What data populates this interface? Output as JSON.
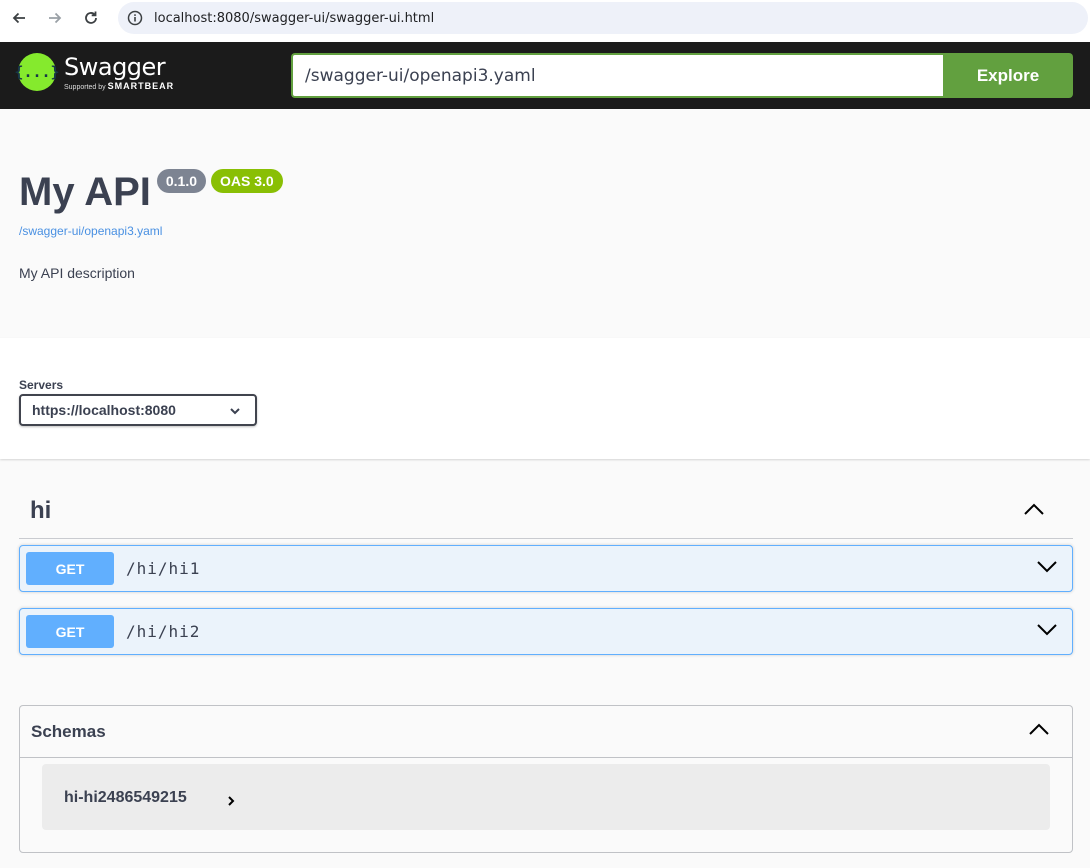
{
  "browser": {
    "url": "localhost:8080/swagger-ui/swagger-ui.html",
    "icons": [
      "back-arrow-icon",
      "forward-arrow-icon",
      "reload-icon",
      "info-icon"
    ]
  },
  "topbar": {
    "logo_glyph": "{...}",
    "logo_title": "Swagger",
    "logo_supported": "Supported by",
    "logo_smartbear": "SMARTBEAR",
    "spec_url_value": "/swagger-ui/openapi3.yaml",
    "explore_label": "Explore",
    "colors": {
      "background": "#1b1b1b",
      "accent": "#62a03f",
      "logo": "#85ea2d"
    }
  },
  "info": {
    "title": "My API",
    "version_badge": "0.1.0",
    "oas_badge": "OAS 3.0",
    "spec_link": "/swagger-ui/openapi3.yaml",
    "description": "My API description",
    "colors": {
      "version_badge": "#7d8492",
      "oas_badge": "#89bf04",
      "link": "#4990e2"
    }
  },
  "servers": {
    "label": "Servers",
    "selected": "https://localhost:8080"
  },
  "tag": {
    "name": "hi",
    "operations": [
      {
        "method": "GET",
        "path": "/hi/hi1"
      },
      {
        "method": "GET",
        "path": "/hi/hi2"
      }
    ],
    "colors": {
      "get": "#61affe",
      "get_bg": "#ebf3fb"
    }
  },
  "schemas": {
    "title": "Schemas",
    "models": [
      {
        "name": "hi-hi2486549215"
      }
    ]
  }
}
